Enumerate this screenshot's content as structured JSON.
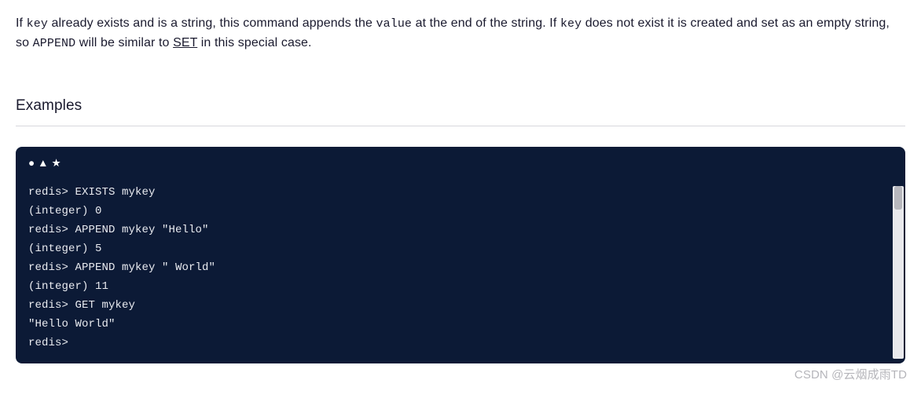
{
  "description": {
    "t1": "If ",
    "code1": "key",
    "t2": " already exists and is a string, this command appends the ",
    "code2": "value",
    "t3": " at the end of the string. If ",
    "code3": "key",
    "t4": " does not exist it is created and set as an empty string, so ",
    "code4": "APPEND",
    "t5": " will be similar to ",
    "link1": "SET",
    "t6": " in this special case."
  },
  "examples_heading": "Examples",
  "cli": {
    "icon_names": "circle-icon triangle-icon star-icon",
    "lines": [
      "redis> EXISTS mykey",
      "(integer) 0",
      "redis> APPEND mykey \"Hello\"",
      "(integer) 5",
      "redis> APPEND mykey \" World\"",
      "(integer) 11",
      "redis> GET mykey",
      "\"Hello World\"",
      "redis>"
    ]
  },
  "watermark": "CSDN @云烟成雨TD"
}
